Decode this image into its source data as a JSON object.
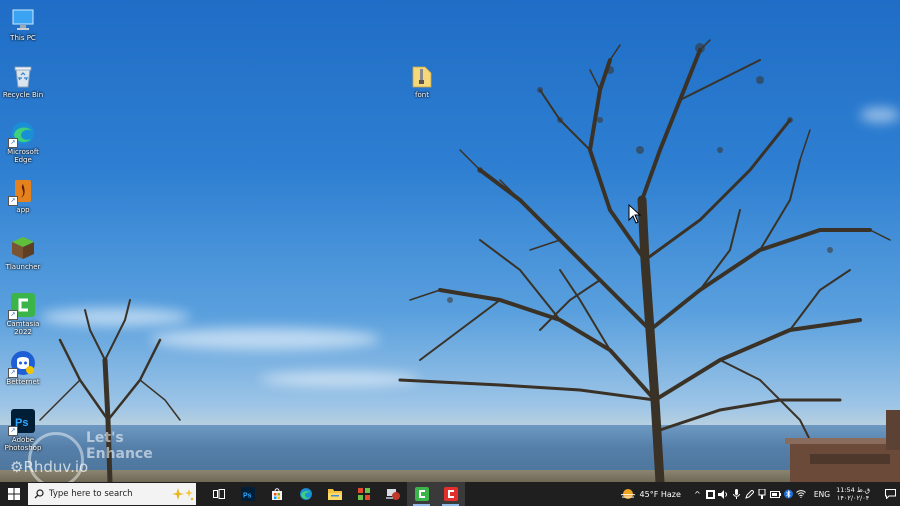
{
  "desktop": {
    "icons": [
      {
        "label": "This PC"
      },
      {
        "label": "Recycle Bin"
      },
      {
        "label": "Microsoft Edge"
      },
      {
        "label": "app"
      },
      {
        "label": "Tlauncher"
      },
      {
        "label": "Camtasia 2022"
      },
      {
        "label": "Betternet"
      },
      {
        "label": "Adobe Photoshop"
      },
      {
        "label": "font"
      }
    ],
    "watermark": {
      "brand": "Let's Enhance",
      "handle": "Rhduv.io"
    }
  },
  "taskbar": {
    "search_placeholder": "Type here to search",
    "apps": [
      {
        "icon": "task-view-icon"
      },
      {
        "icon": "photoshop-icon",
        "text": "Ps"
      },
      {
        "icon": "microsoft-store-icon"
      },
      {
        "icon": "edge-icon"
      },
      {
        "icon": "file-explorer-icon"
      },
      {
        "icon": "app-icon"
      },
      {
        "icon": "network-app-icon"
      },
      {
        "icon": "camtasia-icon"
      },
      {
        "icon": "camtasia-recorder-icon"
      }
    ],
    "weather": {
      "text": "45°F  Haze"
    },
    "language": "ENG",
    "clock": {
      "time": "11:54 ق.ظ",
      "date": "۱۴۰۲/۰۲/۰۴"
    }
  },
  "colors": {
    "taskbar": "#1f1f1f",
    "sky": "#2e7fd2",
    "camtasia_green": "#3bb44a",
    "camtasia_red": "#e2312d"
  }
}
